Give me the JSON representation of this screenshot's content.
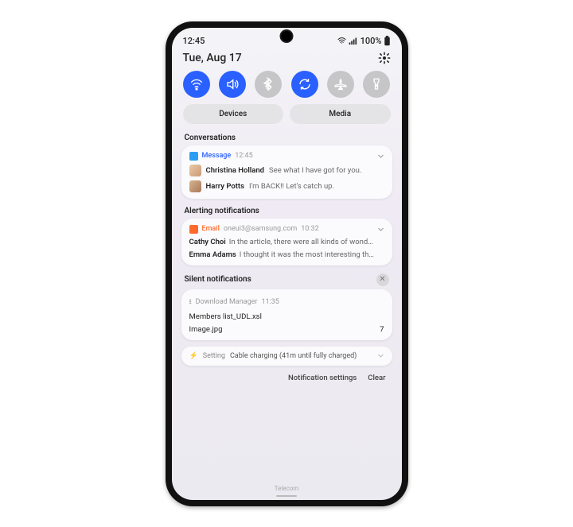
{
  "status": {
    "time": "12:45",
    "battery": "100%"
  },
  "date": "Tue, Aug 17",
  "quick_settings": {
    "toggles": [
      {
        "name": "wifi",
        "active": true
      },
      {
        "name": "sound",
        "active": true
      },
      {
        "name": "bluetooth",
        "active": false
      },
      {
        "name": "rotate",
        "active": true
      },
      {
        "name": "airplane",
        "active": false
      },
      {
        "name": "flashlight",
        "active": false
      }
    ]
  },
  "pills": {
    "devices": "Devices",
    "media": "Media"
  },
  "sections": {
    "conversations_label": "Conversations",
    "alerting_label": "Alerting notifications",
    "silent_label": "Silent notifications"
  },
  "conversations_card": {
    "app": "Message",
    "time": "12:45",
    "items": [
      {
        "sender": "Christina Holland",
        "preview": "See what I have got for you."
      },
      {
        "sender": "Harry Potts",
        "preview": "I'm BACK!! Let's catch up."
      }
    ]
  },
  "alerting_card": {
    "app": "Email",
    "account": "oneui3@samsung.com",
    "time": "10:32",
    "items": [
      {
        "sender": "Cathy Choi",
        "preview": "In the article, there were all kinds of wond…"
      },
      {
        "sender": "Emma Adams",
        "preview": "I thought it was the most interesting th…"
      }
    ]
  },
  "silent_card": {
    "app": "Download Manager",
    "time": "11:35",
    "files": [
      {
        "name": "Members list_UDL.xsl",
        "count": ""
      },
      {
        "name": "Image.jpg",
        "count": "7"
      }
    ]
  },
  "charging": {
    "label": "Setting",
    "text": "Cable charging (41m until fully charged)"
  },
  "footer": {
    "settings": "Notification settings",
    "clear": "Clear"
  },
  "carrier": "Telecom"
}
